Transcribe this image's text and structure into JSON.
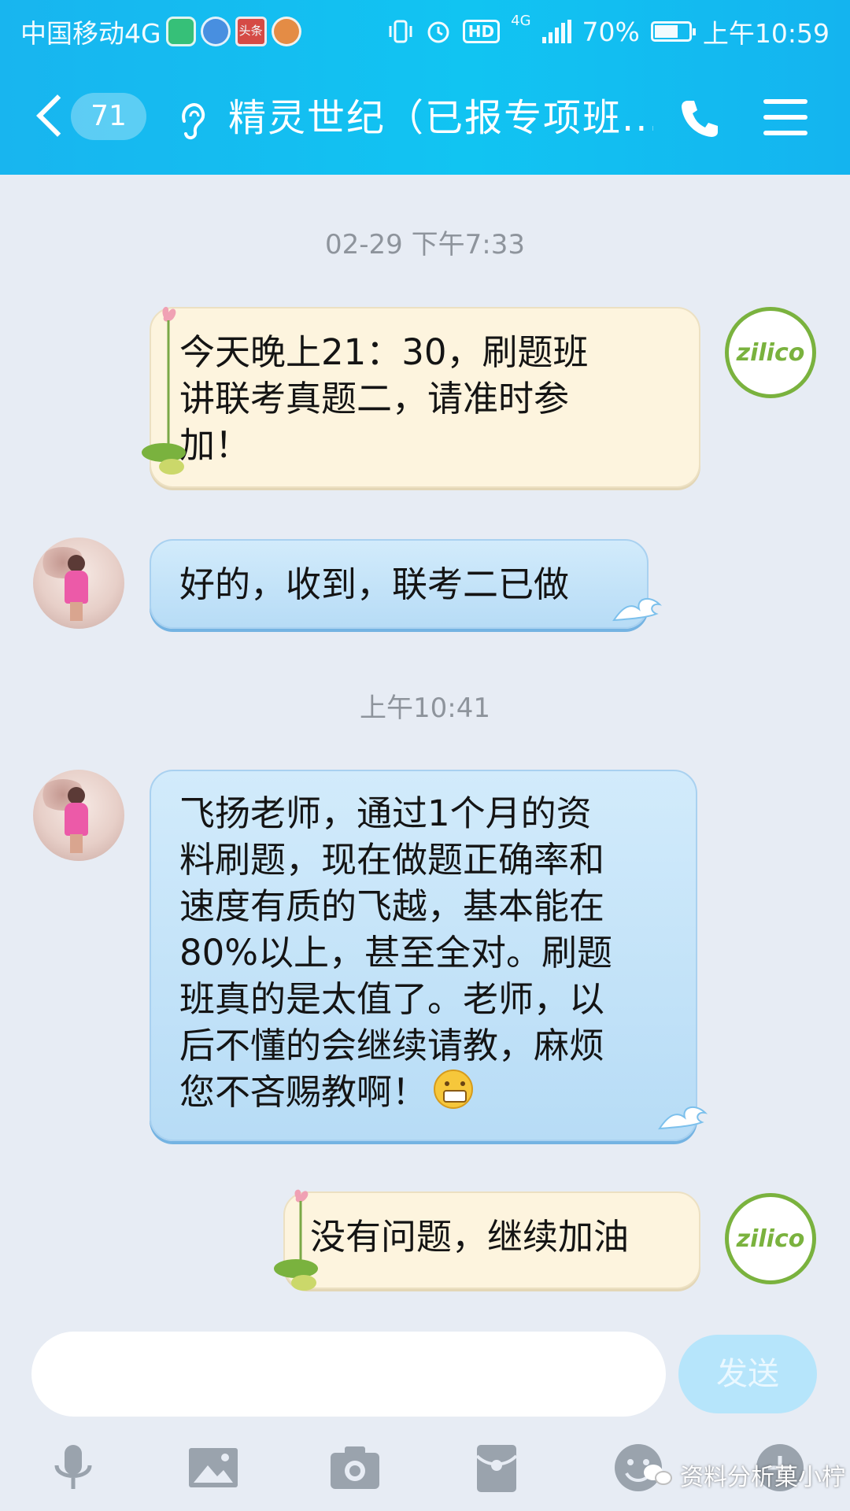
{
  "status_bar": {
    "carrier": "中国移动4G",
    "apps": [
      "play-app-icon",
      "browser-app-icon",
      "toutiao-app-icon",
      "uc-app-icon"
    ],
    "toutiao_label": "头条",
    "hd": "HD",
    "network": "4G",
    "battery": "70%",
    "battery_level": 0.7,
    "time": "上午10:59"
  },
  "header": {
    "unread_count": "71",
    "title": "精灵世纪（已报专项班...",
    "accent_color": "#18b5ef"
  },
  "messages": [
    {
      "type": "time",
      "text": "02-29  下午7:33"
    },
    {
      "type": "out",
      "text": "今天晚上21：30，刷题班\n讲联考真题二，请准时参\n加！",
      "avatar": "zilico"
    },
    {
      "type": "in",
      "text": "好的，收到，联考二已做"
    },
    {
      "type": "time",
      "text": "上午10:41"
    },
    {
      "type": "in",
      "text": "飞扬老师，通过1个月的资\n料刷题，现在做题正确率和\n速度有质的飞越，基本能在\n80%以上，甚至全对。刷题\n班真的是太值了。老师，以\n后不懂的会继续请教，麻烦\n您不吝赐教啊！",
      "emoji": "grin-emoji"
    },
    {
      "type": "out",
      "text": "没有问题，继续加油",
      "avatar": "zilico"
    }
  ],
  "brand_avatar_text": "zilico",
  "input": {
    "placeholder": "",
    "send_label": "发送"
  },
  "toolbar": [
    "mic-icon",
    "image-icon",
    "camera-icon",
    "red-packet-icon",
    "emoji-icon",
    "plus-icon"
  ],
  "watermark": "资料分析菓小柠"
}
